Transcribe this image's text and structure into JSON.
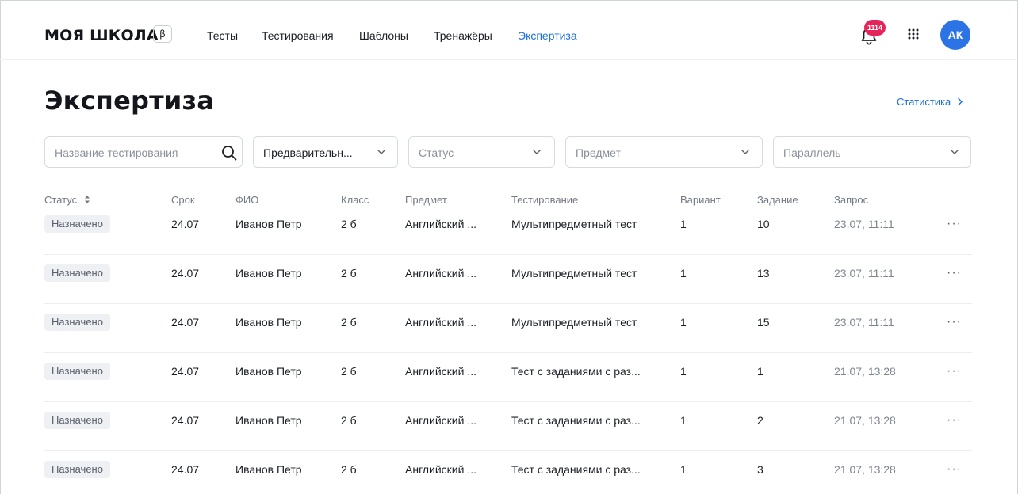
{
  "header": {
    "logo": "МОЯ ШКОЛА",
    "beta": "β",
    "nav": [
      {
        "label": "Тесты",
        "active": false
      },
      {
        "label": "Тестирования",
        "active": false
      },
      {
        "label": "Шаблоны",
        "active": false
      },
      {
        "label": "Тренажёры",
        "active": false
      },
      {
        "label": "Экспертиза",
        "active": true
      }
    ],
    "notifications_count": "1114",
    "avatar_initials": "АК"
  },
  "page": {
    "title": "Экспертиза",
    "stats_link": "Статистика"
  },
  "filters": {
    "search_placeholder": "Название тестирования",
    "mode_value": "Предварительн...",
    "status_placeholder": "Статус",
    "subject_placeholder": "Предмет",
    "parallel_placeholder": "Параллель"
  },
  "table": {
    "columns": [
      "Статус",
      "Срок",
      "ФИО",
      "Класс",
      "Предмет",
      "Тестирование",
      "Вариант",
      "Задание",
      "Запрос"
    ],
    "rows": [
      {
        "status": "Назначено",
        "deadline": "24.07",
        "name": "Иванов Петр",
        "class": "2 б",
        "subject": "Английский ...",
        "testing": "Мультипредметный тест",
        "variant": "1",
        "task": "10",
        "request": "23.07, 11:11"
      },
      {
        "status": "Назначено",
        "deadline": "24.07",
        "name": "Иванов Петр",
        "class": "2 б",
        "subject": "Английский ...",
        "testing": "Мультипредметный тест",
        "variant": "1",
        "task": "13",
        "request": "23.07, 11:11"
      },
      {
        "status": "Назначено",
        "deadline": "24.07",
        "name": "Иванов Петр",
        "class": "2 б",
        "subject": "Английский ...",
        "testing": "Мультипредметный тест",
        "variant": "1",
        "task": "15",
        "request": "23.07, 11:11"
      },
      {
        "status": "Назначено",
        "deadline": "24.07",
        "name": "Иванов Петр",
        "class": "2 б",
        "subject": "Английский ...",
        "testing": "Тест с заданиями с раз...",
        "variant": "1",
        "task": "1",
        "request": "21.07, 13:28"
      },
      {
        "status": "Назначено",
        "deadline": "24.07",
        "name": "Иванов Петр",
        "class": "2 б",
        "subject": "Английский ...",
        "testing": "Тест с заданиями с раз...",
        "variant": "1",
        "task": "2",
        "request": "21.07, 13:28"
      },
      {
        "status": "Назначено",
        "deadline": "24.07",
        "name": "Иванов Петр",
        "class": "2 б",
        "subject": "Английский ...",
        "testing": "Тест с заданиями с раз...",
        "variant": "1",
        "task": "3",
        "request": "21.07, 13:28"
      }
    ],
    "row_actions_label": "···"
  },
  "colors": {
    "accent": "#1f6fe0",
    "badge": "#e5245a",
    "avatar": "#2c73e6"
  },
  "icons": [
    "bell-icon",
    "apps-grid-icon",
    "search-icon",
    "chevron-down-icon",
    "chevron-right-icon",
    "sort-icon",
    "more-icon"
  ]
}
